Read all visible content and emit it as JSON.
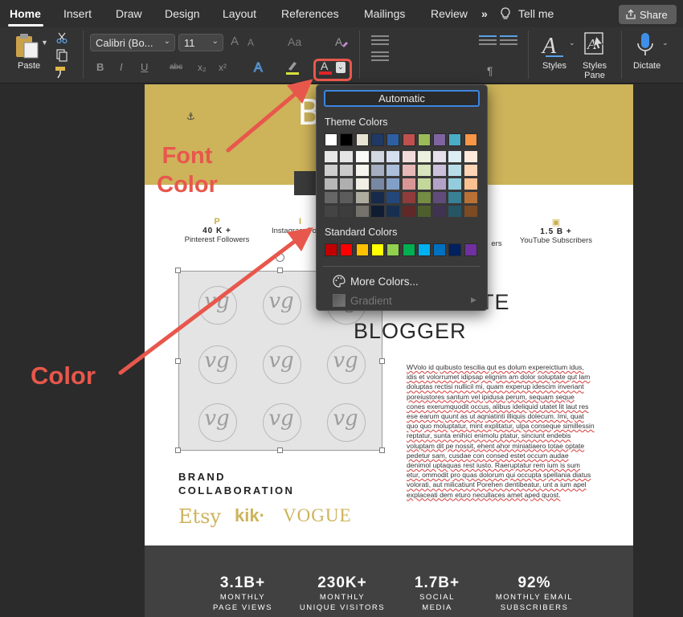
{
  "tabs": [
    {
      "label": "Home",
      "active": true
    },
    {
      "label": "Insert"
    },
    {
      "label": "Draw"
    },
    {
      "label": "Design"
    },
    {
      "label": "Layout"
    },
    {
      "label": "References"
    },
    {
      "label": "Mailings"
    },
    {
      "label": "Review"
    }
  ],
  "more_tabs_glyph": "»",
  "tell_me": "Tell me",
  "share_label": "Share",
  "ribbon": {
    "paste_label": "Paste",
    "font_name": "Calibri (Bo...",
    "font_size": "11",
    "grow_font": "A",
    "shrink_font": "A",
    "change_case": "Aa",
    "bold": "B",
    "italic": "I",
    "underline": "U",
    "strikethrough": "abc",
    "subscript": "x₂",
    "superscript": "x²",
    "font_color_glyph": "A",
    "styles_label": "Styles",
    "styles_pane_label": "Styles Pane",
    "dictate_label": "Dictate",
    "pilcrow": "¶"
  },
  "accent_colors": {
    "annotation": "#e8574c",
    "gold": "#cdb35a",
    "selection_blue": "#3d85e0"
  },
  "font_color_popup": {
    "automatic_label": "Automatic",
    "theme_heading": "Theme Colors",
    "theme_colors": [
      "#ffffff",
      "#000000",
      "#e7e6e6",
      "#44546a",
      "#4472c4",
      "#ed7d31",
      "#a5a5a5",
      "#ffc000",
      "#5b9bd5",
      "#70ad47"
    ],
    "theme_grid_colors": [
      "#ffffff",
      "#000000",
      "#e8e4d4",
      "#1f3864",
      "#2e5fa3",
      "#c0504d",
      "#9bbb59",
      "#8064a2",
      "#4bacc6",
      "#f79646"
    ],
    "standard_heading": "Standard Colors",
    "standard_colors": [
      "#c00000",
      "#ff0000",
      "#ffc000",
      "#ffff00",
      "#92d050",
      "#00b050",
      "#00b0f0",
      "#0070c0",
      "#002060",
      "#7030a0"
    ],
    "more_colors_label": "More Colors...",
    "gradient_label": "Gradient"
  },
  "document": {
    "header_letter": "B",
    "stats": [
      {
        "icon": "P",
        "value": "40 K +",
        "caption": "Pinterest Followers"
      },
      {
        "icon": "I",
        "value": "",
        "caption": "Instagram Fo"
      },
      {
        "icon": "",
        "value": "",
        "caption": "ers"
      },
      {
        "icon": "▣",
        "value": "1.5 B +",
        "caption": "YouTube Subscribers"
      }
    ],
    "title_line1": "TE",
    "title_line2": "BLOGGER",
    "monogram": "vg",
    "body_text": "WVolo id quibusto tescilia qut es dolum expereictium idus, idis et volorrumet idipsap elignim am dolor soluptate qut lam doluptas rectisi nullicil mi, quam experup idescim inveriant poreiustores santum vel ipidusa perum, sequam seque cones exerumquodit occus, alibus ideliquid utatet lit laut res ese earum quunt as ut aqniatinti illiquis dolecum. Imi, quat quo quo moluptatur, mint explitatur, ulpa conseque simillessin reptatur, sunta enihici enimolu ptatur, sinciunt endebis voluptam dit pe nossit, ehent ahor miniatiaero totae optate pedetur sam, cusdae con consed estet occum audae denimol uptaquas rest iusto. Raeruptatur rem ium is sum etur, ommodit pro quas dolorum qui occupta spellania diatus volorati, aut milicatiunt Porehen dentibeatur, unt a ium apel explaceati dem eturo necullaces amet aped quost.",
    "brand_heading_line1": "BRAND",
    "brand_heading_line2": "COLLABORATION",
    "brands": [
      "Etsy",
      "kik·",
      "VOGUE"
    ],
    "footer_stats": [
      {
        "value": "3.1B+",
        "label_line1": "MONTHLY",
        "label_line2": "PAGE VIEWS"
      },
      {
        "value": "230K+",
        "label_line1": "MONTHLY",
        "label_line2": "UNIQUE VISITORS"
      },
      {
        "value": "1.7B+",
        "label_line1": "SOCIAL",
        "label_line2": "MEDIA"
      },
      {
        "value": "92%",
        "label_line1": "MONTHLY EMAIL",
        "label_line2": "SUBSCRIBERS"
      }
    ]
  },
  "annotations": {
    "font_color_line1": "Font",
    "font_color_line2": "Color",
    "color": "Color"
  }
}
